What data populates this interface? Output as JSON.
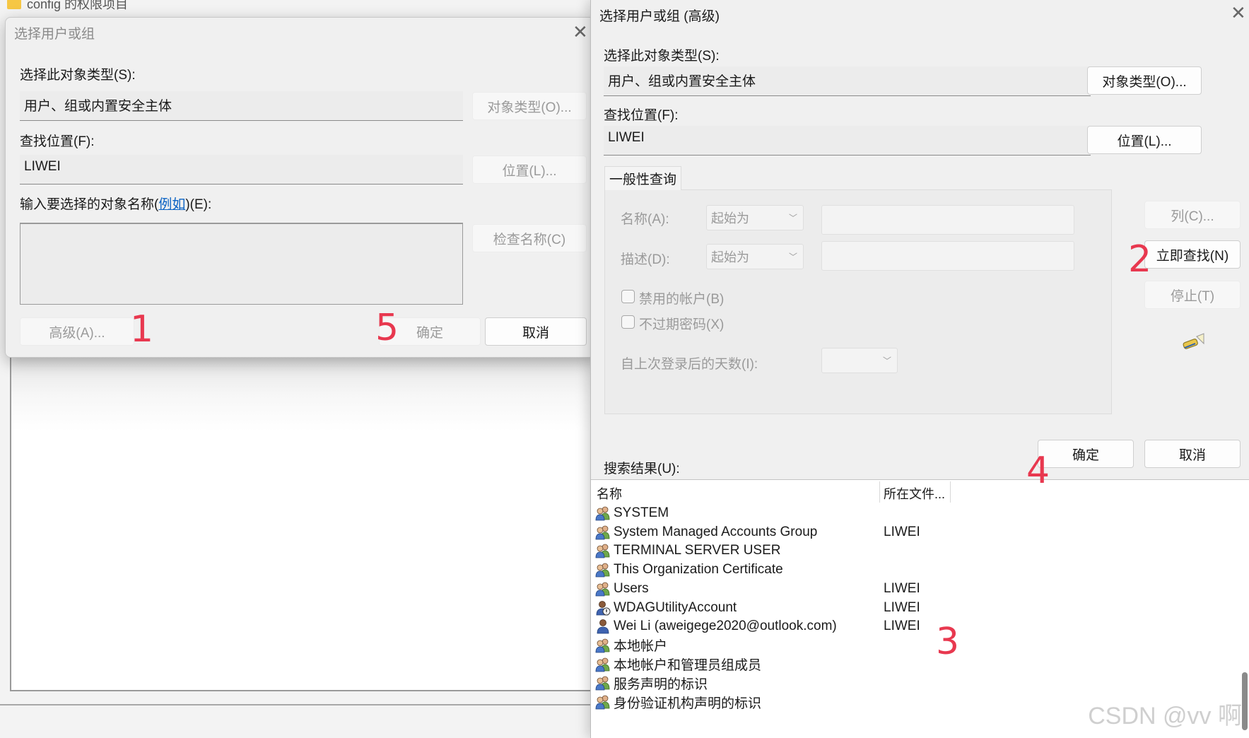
{
  "background": {
    "folder_title": "config 的权限项目"
  },
  "simple_dialog": {
    "title": "选择用户或组",
    "object_type_label": "选择此对象类型(S):",
    "object_type_value": "用户、组或内置安全主体",
    "object_type_button": "对象类型(O)...",
    "location_label": "查找位置(F):",
    "location_value": "LIWEI",
    "location_button": "位置(L)...",
    "enter_names_prefix": "输入要选择的对象名称(",
    "examples_link": "例如",
    "enter_names_suffix": ")(E):",
    "check_names_button": "检查名称(C)",
    "advanced_button": "高级(A)...",
    "ok_button": "确定",
    "cancel_button": "取消"
  },
  "advanced_dialog": {
    "title": "选择用户或组 (高级)",
    "object_type_label": "选择此对象类型(S):",
    "object_type_value": "用户、组或内置安全主体",
    "object_type_button": "对象类型(O)...",
    "location_label": "查找位置(F):",
    "location_value": "LIWEI",
    "location_button": "位置(L)...",
    "common_queries_tab": "一般性查询",
    "name_label": "名称(A):",
    "name_combo": "起始为",
    "description_label": "描述(D):",
    "description_combo": "起始为",
    "disabled_accounts": "禁用的帐户(B)",
    "non_expiring_passwords": "不过期密码(X)",
    "days_since_logon": "自上次登录后的天数(I):",
    "columns_button": "列(C)...",
    "find_now_button": "立即查找(N)",
    "stop_button": "停止(T)",
    "ok_button": "确定",
    "cancel_button": "取消",
    "search_results_label": "搜索结果(U):",
    "columns": [
      "名称",
      "所在文件..."
    ],
    "results": [
      {
        "name": "SYSTEM",
        "location": "",
        "icon": "group-icon"
      },
      {
        "name": "System Managed Accounts Group",
        "location": "LIWEI",
        "icon": "group-icon"
      },
      {
        "name": "TERMINAL SERVER USER",
        "location": "",
        "icon": "group-icon"
      },
      {
        "name": "This Organization Certificate",
        "location": "",
        "icon": "group-icon"
      },
      {
        "name": "Users",
        "location": "LIWEI",
        "icon": "group-icon"
      },
      {
        "name": "WDAGUtilityAccount",
        "location": "LIWEI",
        "icon": "disabled-user-icon"
      },
      {
        "name": "Wei Li (aweigege2020@outlook.com)",
        "location": "LIWEI",
        "icon": "user-icon"
      },
      {
        "name": "本地帐户",
        "location": "",
        "icon": "group-icon"
      },
      {
        "name": "本地帐户和管理员组成员",
        "location": "",
        "icon": "group-icon"
      },
      {
        "name": "服务声明的标识",
        "location": "",
        "icon": "group-icon"
      },
      {
        "name": "身份验证机构声明的标识",
        "location": "",
        "icon": "group-icon"
      }
    ]
  },
  "markers": [
    "1",
    "2",
    "3",
    "4",
    "5"
  ],
  "watermark": "CSDN @vv 啊",
  "colors": {
    "marker": "#e8384f",
    "link": "#0b63c4"
  }
}
